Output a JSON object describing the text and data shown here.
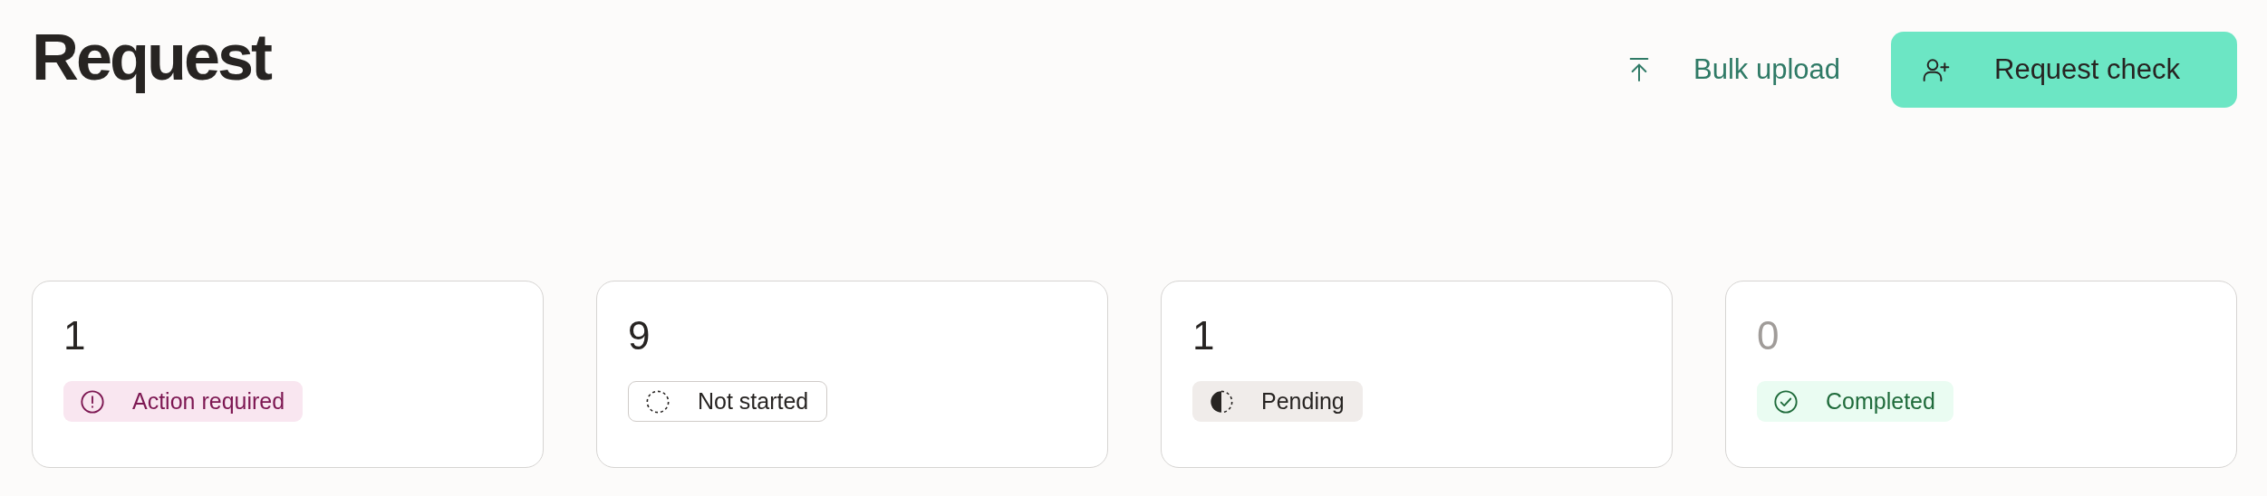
{
  "header": {
    "title": "Request",
    "actions": [
      {
        "kind": "link",
        "label": "Bulk upload"
      },
      {
        "kind": "primary",
        "label": "Request check"
      }
    ]
  },
  "stats": [
    {
      "count": "1",
      "dimmed": false,
      "kind": "action",
      "label": "Action required"
    },
    {
      "count": "9",
      "dimmed": false,
      "kind": "not_started",
      "label": "Not started"
    },
    {
      "count": "1",
      "dimmed": false,
      "kind": "pending",
      "label": "Pending"
    },
    {
      "count": "0",
      "dimmed": true,
      "kind": "completed",
      "label": "Completed"
    }
  ]
}
